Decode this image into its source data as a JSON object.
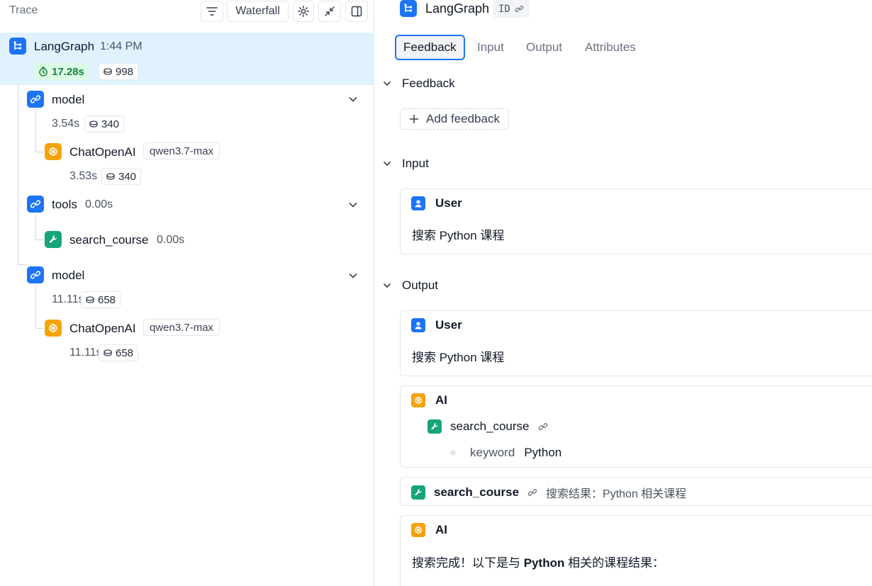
{
  "trace_panel": {
    "title": "Trace",
    "toolbar": {
      "view_mode_label": "Waterfall"
    },
    "root": {
      "name": "LangGraph",
      "time": "1:44 PM",
      "duration": "17.28s",
      "tokens": "998"
    },
    "nodes": [
      {
        "name": "model",
        "duration": "3.54s",
        "tokens": "340",
        "child": {
          "name": "ChatOpenAI",
          "model_tag": "qwen3.7-max",
          "duration": "3.53s",
          "tokens": "340"
        }
      },
      {
        "name": "tools",
        "duration": "0.00s",
        "child": {
          "name": "search_course",
          "duration": "0.00s"
        }
      },
      {
        "name": "model",
        "duration": "11.11s",
        "tokens": "658",
        "child": {
          "name": "ChatOpenAI",
          "model_tag": "qwen3.7-max",
          "duration": "11.11s",
          "tokens": "658"
        }
      }
    ]
  },
  "detail_panel": {
    "title": "LangGraph",
    "id_label": "ID",
    "tabs": [
      "Feedback",
      "Input",
      "Output",
      "Attributes"
    ],
    "active_tab": "Feedback",
    "feedback": {
      "heading": "Feedback",
      "add_label": "Add feedback"
    },
    "input": {
      "heading": "Input",
      "messages": [
        {
          "role": "User",
          "text": "搜索 Python 课程"
        }
      ]
    },
    "output": {
      "heading": "Output",
      "user_message": {
        "role": "User",
        "text": "搜索 Python 课程"
      },
      "ai_tool_call": {
        "role": "AI",
        "tool_name": "search_course",
        "arg_key": "keyword",
        "arg_value": "Python"
      },
      "tool_result": {
        "tool_name": "search_course",
        "result": "搜索结果：Python 相关课程"
      },
      "ai_final": {
        "role": "AI",
        "text_before": "搜索完成！以下是与 ",
        "text_bold": "Python",
        "text_after": " 相关的课程结果："
      }
    }
  },
  "colors": {
    "accent": "#1d74f5",
    "selected_row": "#e0f2fe",
    "llm_icon": "#f5a30b",
    "tool_icon": "#16a57a",
    "duration_green": "#15803d"
  }
}
